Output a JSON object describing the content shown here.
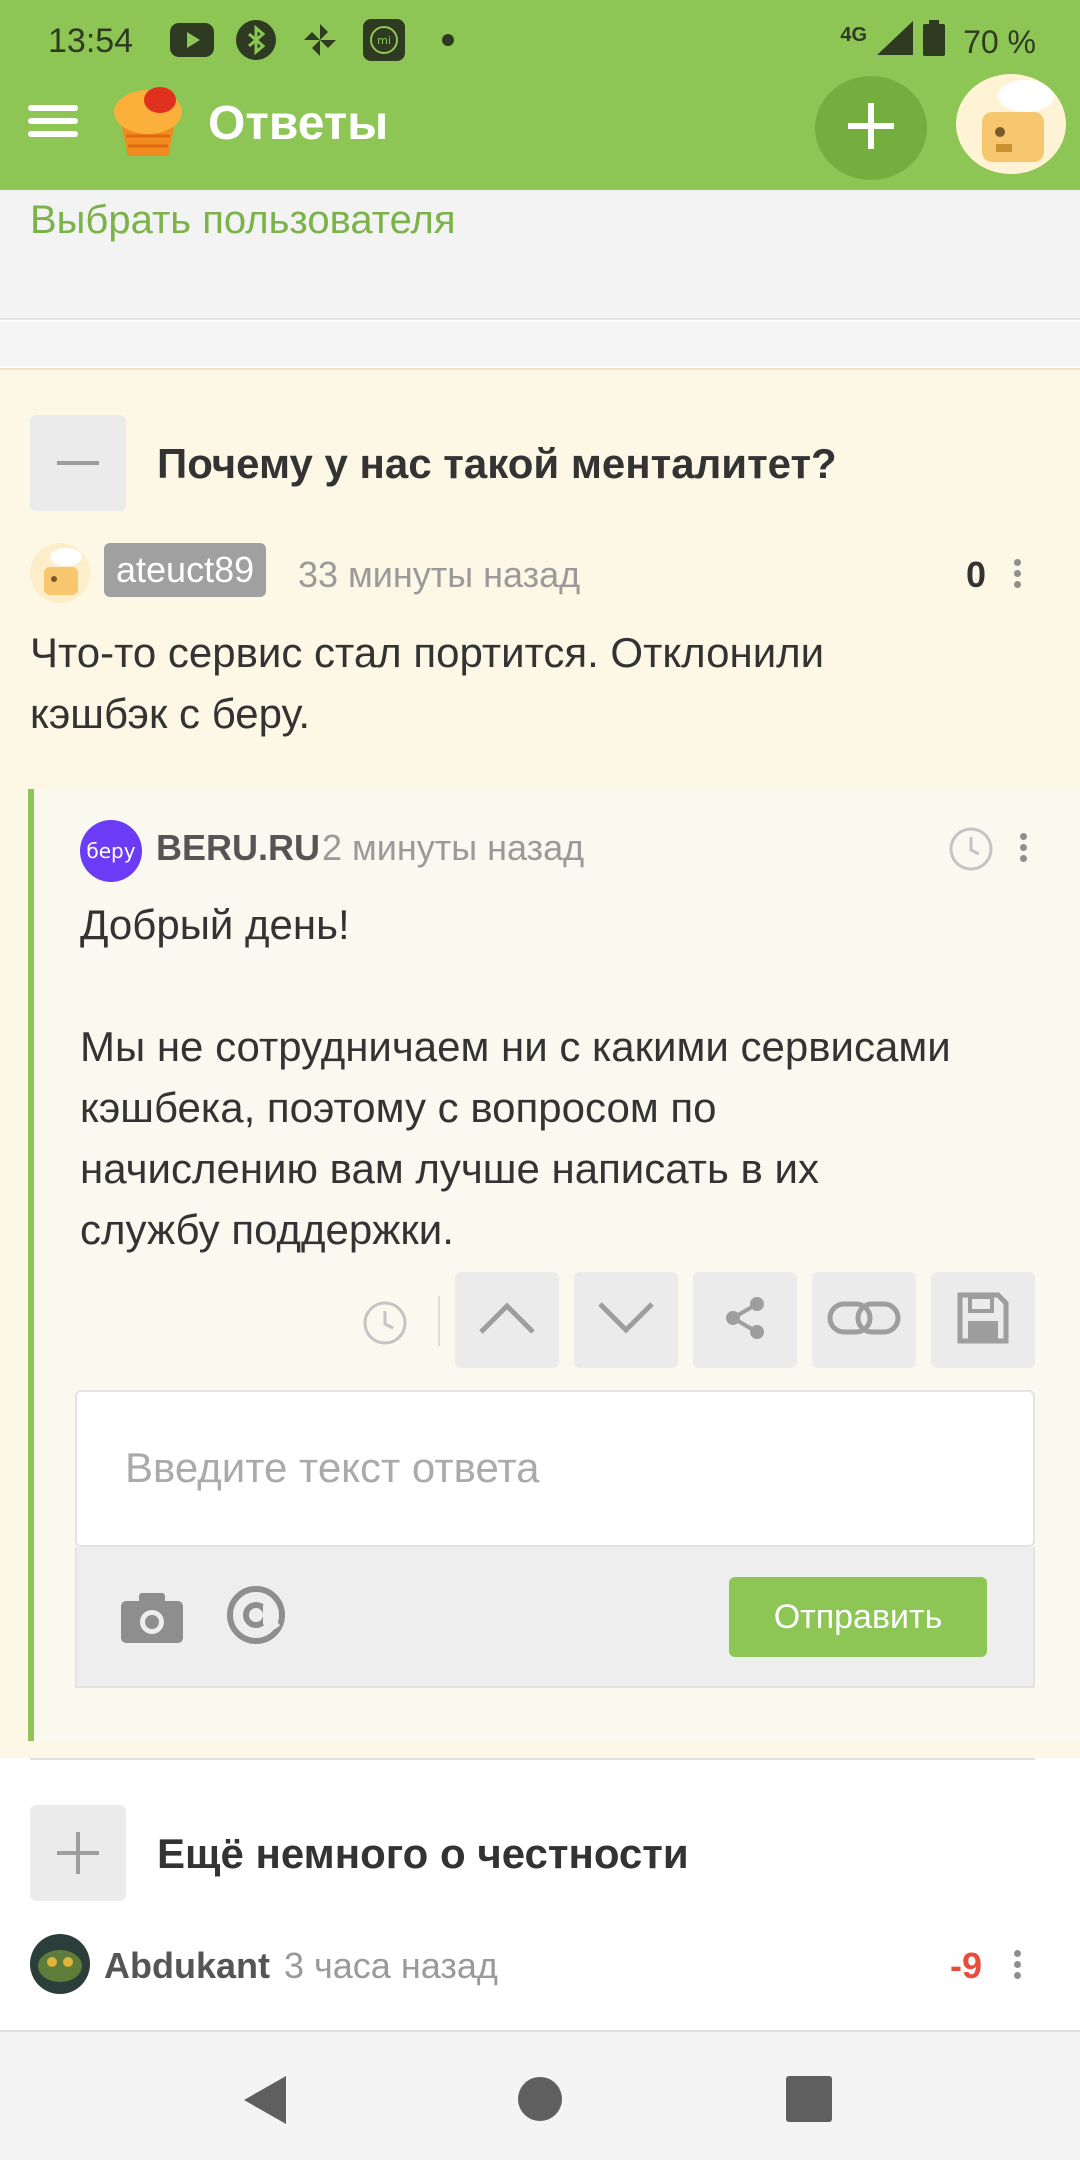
{
  "status_bar": {
    "time": "13:54",
    "network": "4G",
    "battery": "70 %",
    "icons": [
      "youtube-icon",
      "bluetooth-icon",
      "pinwheel-icon",
      "mi-icon",
      "dot-icon"
    ]
  },
  "app_bar": {
    "title": "Ответы",
    "menu_icon": "hamburger-icon",
    "add_icon": "plus-icon",
    "accent_color": "#8dc655"
  },
  "filter": {
    "pick_user_label": "Выбрать пользователя"
  },
  "thread_1": {
    "title": "Почему у нас такой менталитет?",
    "comment": {
      "author": "ateuct89",
      "time": "33 минуты назад",
      "score": "0",
      "text_line1": "Что-то сервис стал портится. Отклонили",
      "text_line2": "кэшбэк с беру."
    },
    "reply": {
      "logo_text": "беру",
      "author": "BERU.RU",
      "time": "2 минуты назад",
      "greeting": "Добрый день!",
      "body_line1": "Мы не сотрудничаем ни с какими сервисами",
      "body_line2": "кэшбека, поэтому с вопросом по",
      "body_line3": "начислению вам лучше написать в их",
      "body_line4": "службу поддержки."
    },
    "composer": {
      "placeholder": "Введите текст ответа",
      "send_label": "Отправить"
    }
  },
  "thread_2": {
    "title": "Ещё немного о честности",
    "comment": {
      "author": "Abdukant",
      "time": "3 часа назад",
      "score": "-9",
      "score_color": "#e74c3c"
    }
  }
}
